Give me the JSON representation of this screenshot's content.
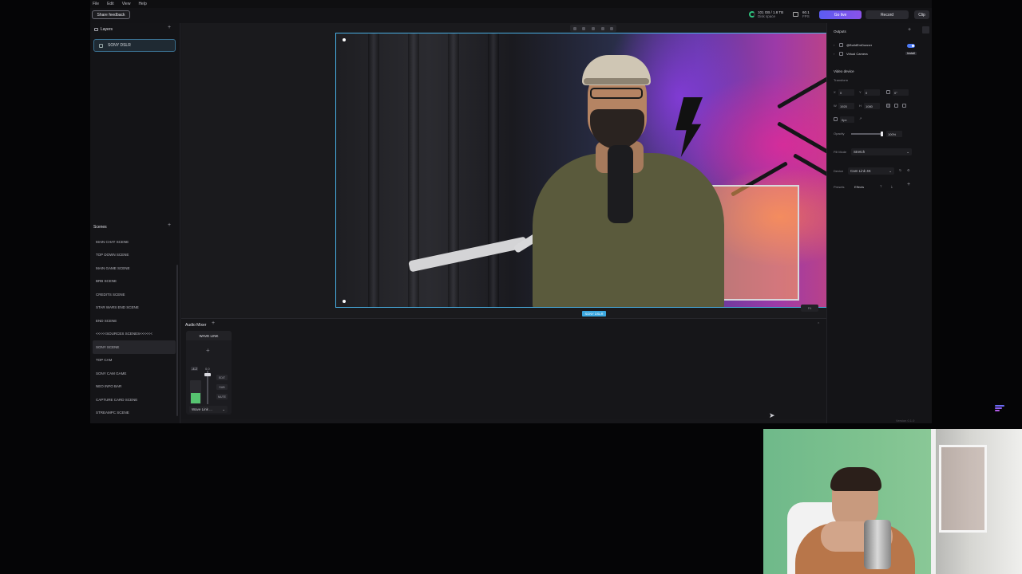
{
  "menu": [
    "File",
    "Edit",
    "View",
    "Help"
  ],
  "topbar": {
    "share_feedback": "Share feedback",
    "disk_value": "101 GB / 1.8 TB",
    "disk_label": "Disk space",
    "fps_value": "60.1",
    "fps_label": "FPS",
    "go_live": "Go live",
    "record": "Record",
    "clip": "Clip"
  },
  "layers": {
    "title": "Layers",
    "items": [
      {
        "label": "SONY DSLR"
      }
    ]
  },
  "scenes": {
    "title": "Scenes",
    "items": [
      "MAIN CHAT SCENE",
      "TOP DOWN SCENE",
      "MAIN GAME SCENE",
      "BRB SCENE",
      "CREDITS SCENE",
      "STAR WARS END SCENE",
      "END SCENE",
      "<<<<<SOURCES SCENES<<<<<<",
      "SONY SCENE",
      "TOP CAM",
      "SONY CAM GAME",
      "NEO INFO BAR",
      "CAPTURE CARD SCENE",
      "STREAMPC SCENE"
    ],
    "active": "SONY SCENE"
  },
  "canvas": {
    "preview_label": "SONY DSLR",
    "zoom": "Fit"
  },
  "audio_mixer": {
    "title": "Audio Mixer",
    "channel": {
      "name": "WAVE LINK",
      "db": "-4.2",
      "level_fraction": 0.45,
      "fader_label": "0.0",
      "buttons": [
        "EDIT",
        "SUB",
        "MUTE"
      ],
      "device": "Wave Link ..."
    }
  },
  "outputs": {
    "title": "Outputs",
    "items": [
      {
        "label": "@BuildEmDonner",
        "toggle": true
      },
      {
        "label": "Virtual Camera",
        "badge": "Install"
      }
    ]
  },
  "video_device": {
    "title": "Video device",
    "transform_label": "Transform",
    "x_label": "X",
    "x": "0",
    "y_label": "Y",
    "y": "0",
    "rotation": "0°",
    "w_label": "W",
    "width": "1920",
    "h_label": "H",
    "height": "1080",
    "radius": "0px",
    "opacity_label": "Opacity",
    "opacity": "100%",
    "fill_mode_label": "Fill Mode",
    "fill_mode": "Stretch",
    "device_label": "Device",
    "device": "Cam Link 4K",
    "presets_label": "Presets",
    "effects_label": "Effects"
  },
  "footer": {
    "version": "Version 0.1.0"
  }
}
